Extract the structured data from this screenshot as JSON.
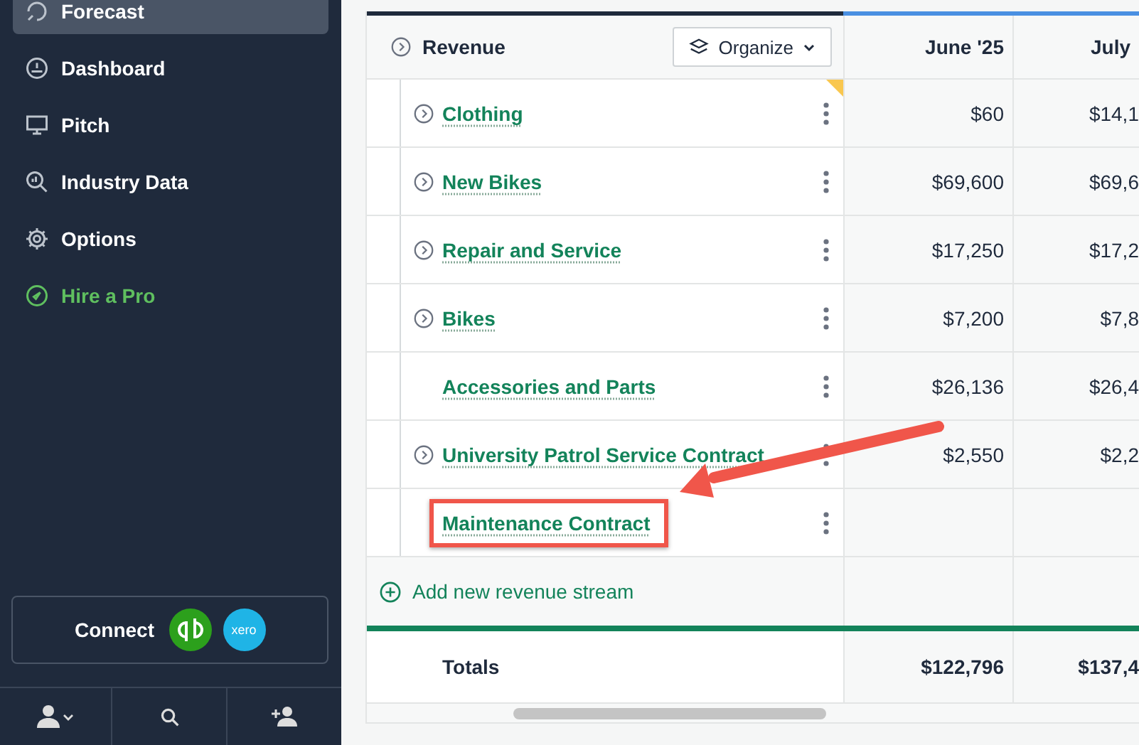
{
  "sidebar": {
    "nav": [
      {
        "label": "Forecast",
        "selected": true,
        "kind": "link"
      },
      {
        "label": "Dashboard",
        "selected": false,
        "kind": "link"
      },
      {
        "label": "Pitch",
        "selected": false,
        "kind": "link"
      },
      {
        "label": "Industry Data",
        "selected": false,
        "kind": "link"
      },
      {
        "label": "Options",
        "selected": false,
        "kind": "link"
      },
      {
        "label": "Hire a Pro",
        "selected": false,
        "kind": "promo"
      }
    ],
    "connect": {
      "label": "Connect",
      "xero_logo_text": "xero"
    }
  },
  "table": {
    "title": "Revenue",
    "organize_label": "Organize",
    "columns": [
      "June '25",
      "July"
    ],
    "rows": [
      {
        "name": "Clothing",
        "expandable": true,
        "flagged": true,
        "highlighted": false,
        "values": [
          "$60",
          "$14,1"
        ]
      },
      {
        "name": "New Bikes",
        "expandable": true,
        "flagged": false,
        "highlighted": false,
        "values": [
          "$69,600",
          "$69,6"
        ]
      },
      {
        "name": "Repair and Service",
        "expandable": true,
        "flagged": false,
        "highlighted": false,
        "values": [
          "$17,250",
          "$17,2"
        ]
      },
      {
        "name": "Bikes",
        "expandable": true,
        "flagged": false,
        "highlighted": false,
        "values": [
          "$7,200",
          "$7,8"
        ]
      },
      {
        "name": "Accessories and Parts",
        "expandable": false,
        "flagged": false,
        "highlighted": false,
        "values": [
          "$26,136",
          "$26,4"
        ]
      },
      {
        "name": "University Patrol Service Contract",
        "expandable": true,
        "flagged": false,
        "highlighted": false,
        "values": [
          "$2,550",
          "$2,2"
        ]
      },
      {
        "name": "Maintenance Contract",
        "expandable": false,
        "flagged": false,
        "highlighted": true
      }
    ],
    "add_label": "Add new revenue stream",
    "totals": {
      "label": "Totals",
      "values": [
        "$122,796",
        "$137,4"
      ]
    }
  }
}
